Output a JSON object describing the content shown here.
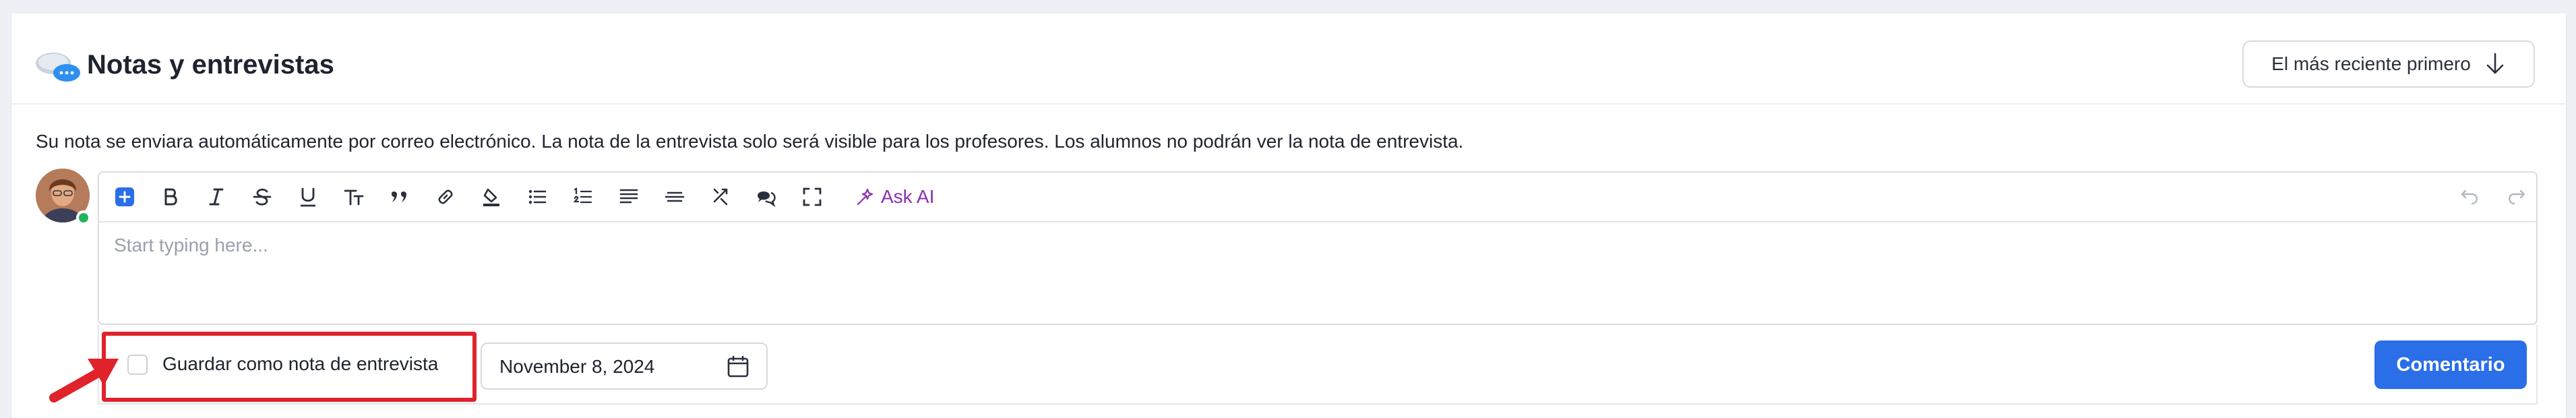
{
  "header": {
    "title": "Notas y entrevistas",
    "title_icon": "speech-bubbles-icon",
    "sort_label": "El más reciente primero",
    "sort_icon": "arrow-down-icon"
  },
  "info_text": "Su nota se enviara automáticamente por correo electrónico. La nota de la entrevista solo será visible para los profesores. Los alumnos no podrán ver la nota de entrevista.",
  "editor": {
    "placeholder": "Start typing here...",
    "toolbar": {
      "items": [
        "insert-icon",
        "bold-icon",
        "italic-icon",
        "strikethrough-icon",
        "underline-icon",
        "text-size-icon",
        "quote-icon",
        "link-icon",
        "highlight-icon",
        "bullet-list-icon",
        "numbered-list-icon",
        "align-icon",
        "horizontal-rule-icon",
        "merge-icon",
        "comment-icon",
        "fullscreen-icon"
      ],
      "ask_ai_label": "Ask AI",
      "undo_icon": "undo-icon",
      "redo_icon": "redo-icon"
    }
  },
  "footer": {
    "checkbox_label": "Guardar como nota de entrevista",
    "checkbox_checked": false,
    "date_value": "November 8, 2024",
    "submit_label": "Comentario"
  },
  "colors": {
    "accent": "#2a6ee8",
    "highlight": "#e0222b",
    "ai": "#8b2fb0",
    "online": "#22b35e"
  }
}
